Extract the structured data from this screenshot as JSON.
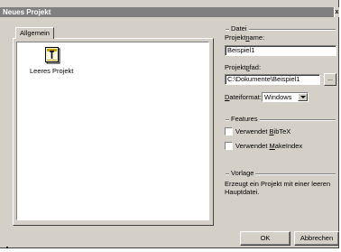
{
  "window": {
    "title": "Neues Projekt",
    "close_glyph": "x"
  },
  "tabs": [
    {
      "label": "Allgemein",
      "selected": true
    }
  ],
  "templates": [
    {
      "label": "Leeres Projekt",
      "icon": "blank-document-icon",
      "icon_accent": "#c8a000"
    }
  ],
  "datei": {
    "group_title": "Datei",
    "projektname_label": {
      "pre": "Projekt",
      "accel": "n",
      "post": "ame:"
    },
    "projektname_value": "Beispiel1",
    "projektpfad_label": {
      "pre": "Projekt",
      "accel": "p",
      "post": "fad:"
    },
    "projektpfad_value": "C:\\Dokumente\\Beispiel1",
    "browse_label": "...",
    "dateiformat_label": {
      "pre": "",
      "accel": "D",
      "post": "ateiformat:"
    },
    "dateiformat_value": "Windows"
  },
  "features": {
    "group_title": "Features",
    "bibtex": {
      "pre": "Verwendet ",
      "accel": "B",
      "post": "ibTeX",
      "checked": false
    },
    "makeindex": {
      "pre": "Verwendet ",
      "accel": "M",
      "post": "akeIndex",
      "checked": false
    }
  },
  "vorlage": {
    "group_title": "Vorlage",
    "description": "Erzeugt ein Projekt mit einer leeren Hauptdatei."
  },
  "buttons": {
    "ok": "OK",
    "cancel": "Abbrechen"
  },
  "colors": {
    "face": "#d4d0c8",
    "titlebar": "#808080"
  }
}
